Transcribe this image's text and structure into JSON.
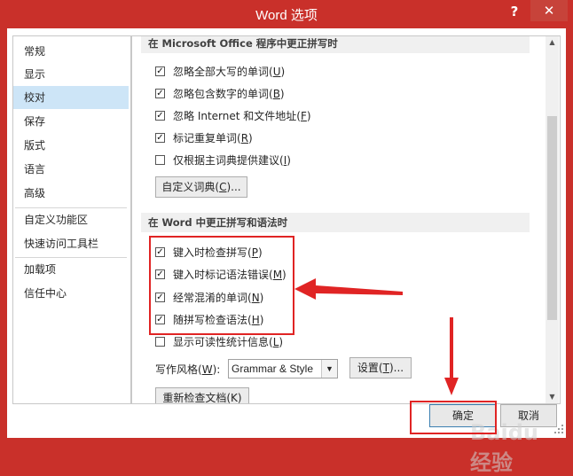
{
  "window": {
    "title": "Word 选项",
    "help_glyph": "?",
    "close_glyph": "✕"
  },
  "sidebar": {
    "items": [
      {
        "label": "常规"
      },
      {
        "label": "显示"
      },
      {
        "label": "校对",
        "selected": true
      },
      {
        "label": "保存"
      },
      {
        "label": "版式"
      },
      {
        "label": "语言"
      },
      {
        "label": "高级"
      },
      {
        "label": "自定义功能区"
      },
      {
        "label": "快速访问工具栏"
      },
      {
        "label": "加载项"
      },
      {
        "label": "信任中心"
      }
    ]
  },
  "sections": {
    "office_header": "在 Microsoft Office 程序中更正拼写时",
    "office_options": [
      {
        "label": "忽略全部大写的单词(",
        "key": "U",
        "suffix": ")",
        "checked": true
      },
      {
        "label": "忽略包含数字的单词(",
        "key": "B",
        "suffix": ")",
        "checked": true
      },
      {
        "label": "忽略 Internet 和文件地址(",
        "key": "F",
        "suffix": ")",
        "checked": true
      },
      {
        "label": "标记重复单词(",
        "key": "R",
        "suffix": ")",
        "checked": true
      },
      {
        "label": "仅根据主词典提供建议(",
        "key": "I",
        "suffix": ")",
        "checked": false
      }
    ],
    "custom_dict_button": {
      "label": "自定义词典(",
      "key": "C",
      "suffix": ")..."
    },
    "word_header": "在 Word 中更正拼写和语法时",
    "word_options": [
      {
        "label": "键入时检查拼写(",
        "key": "P",
        "suffix": ")",
        "checked": true
      },
      {
        "label": "键入时标记语法错误(",
        "key": "M",
        "suffix": ")",
        "checked": true
      },
      {
        "label": "经常混淆的单词(",
        "key": "N",
        "suffix": ")",
        "checked": true
      },
      {
        "label": "随拼写检查语法(",
        "key": "H",
        "suffix": ")",
        "checked": true
      },
      {
        "label": "显示可读性统计信息(",
        "key": "L",
        "suffix": ")",
        "checked": false
      }
    ],
    "writing_style": {
      "label": "写作风格(",
      "key": "W",
      "suffix": "):",
      "value": "Grammar & Style",
      "settings_button": {
        "label": "设置(",
        "key": "T",
        "suffix": ")..."
      }
    },
    "recheck_button": {
      "label": "重新检查文档(K)"
    }
  },
  "footer": {
    "ok_label": "确定",
    "cancel_label": "取消"
  },
  "watermark": "Baidu 经验",
  "colors": {
    "title_bar": "#c9302a",
    "annotation": "#e02424",
    "selected_nav": "#cde5f7"
  }
}
